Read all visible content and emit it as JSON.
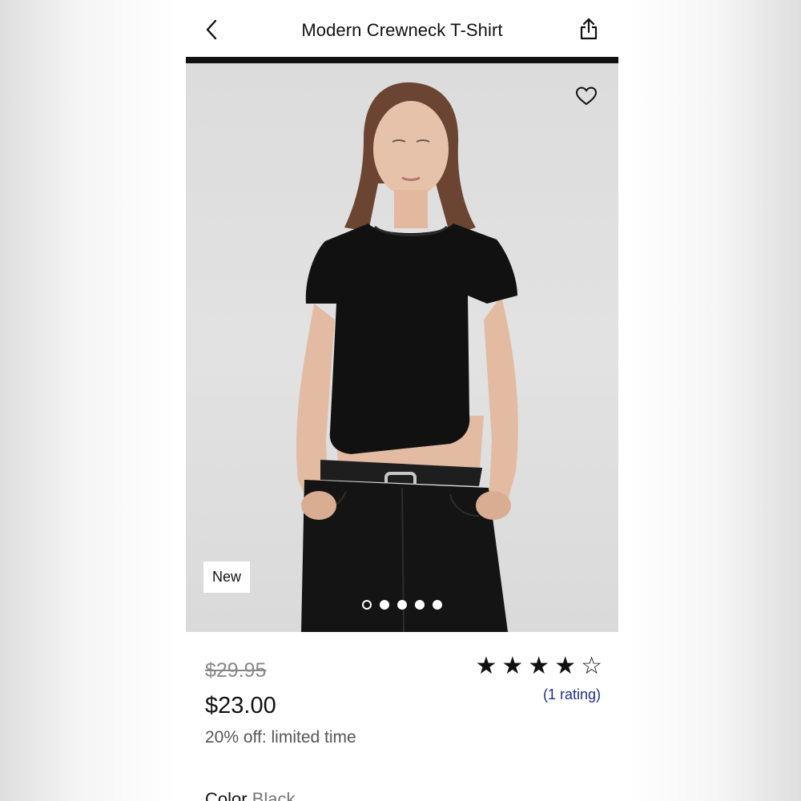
{
  "header": {
    "title": "Modern Crewneck T-Shirt",
    "back_icon": "chevron-left-icon",
    "share_icon": "share-icon"
  },
  "hero": {
    "badge": "New",
    "favorite_icon": "heart-outline-icon",
    "carousel": {
      "total": 5,
      "active_index": 0
    }
  },
  "pricing": {
    "original": "$29.95",
    "sale": "$23.00",
    "promo": "20% off: limited time"
  },
  "rating": {
    "stars": 4,
    "max": 5,
    "link_text": "(1 rating)"
  },
  "color": {
    "label": "Color",
    "value": "Black"
  },
  "colors": {
    "link": "#1f2e8a",
    "text": "#111111",
    "muted": "#888888"
  }
}
